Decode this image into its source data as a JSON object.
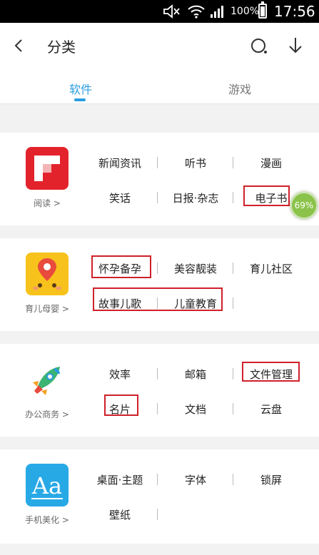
{
  "status_bar": {
    "battery": "100%",
    "time": "17:56"
  },
  "header": {
    "title": "分类"
  },
  "tabs": [
    {
      "label": "软件"
    },
    {
      "label": "游戏"
    }
  ],
  "categories": [
    {
      "label": "阅读 >",
      "items": [
        "新闻资讯",
        "听书",
        "漫画",
        "笑话",
        "日报·杂志",
        "电子书"
      ]
    },
    {
      "label": "育儿母婴 >",
      "items": [
        "怀孕备孕",
        "美容靓装",
        "育儿社区",
        "故事儿歌",
        "儿童教育"
      ]
    },
    {
      "label": "办公商务 >",
      "items": [
        "效率",
        "邮箱",
        "文件管理",
        "名片",
        "文档",
        "云盘"
      ]
    },
    {
      "label": "手机美化 >",
      "items": [
        "桌面·主题",
        "字体",
        "锁屏",
        "壁纸"
      ]
    }
  ],
  "download_badge": "69%",
  "colors": {
    "accent": "#2a9de0",
    "highlight": "#d0202a",
    "badge": "#8bc34a"
  }
}
